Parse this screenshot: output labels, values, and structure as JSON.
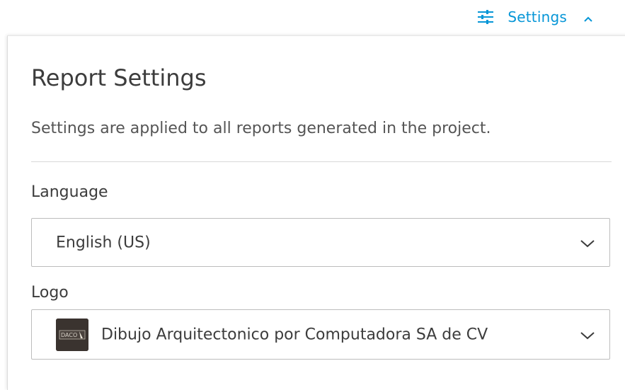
{
  "header": {
    "settings_label": "Settings",
    "settings_icon": "sliders-icon",
    "toggle_icon": "chevron-up-icon",
    "accent_color": "#0696d7"
  },
  "panel": {
    "title": "Report Settings",
    "description": "Settings are applied to all reports generated in the project.",
    "language": {
      "label": "Language",
      "selected": "English (US)",
      "icon": "chevron-down-icon"
    },
    "logo": {
      "label": "Logo",
      "selected": "Dibujo Arquitectonico por Computadora SA de CV",
      "thumbnail_text": "DACO",
      "icon": "chevron-down-icon"
    }
  }
}
